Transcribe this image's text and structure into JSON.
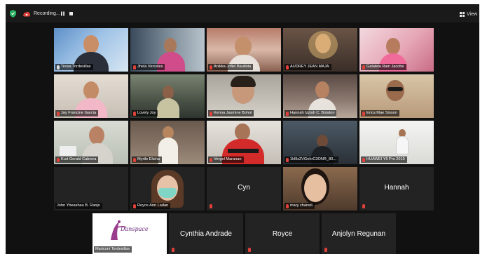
{
  "topbar": {
    "recording_label": "Recording...",
    "view_label": "View"
  },
  "colors": {
    "background": "#111111",
    "active_speaker_border": "#c9dc3c",
    "muted_mic": "#e0413a",
    "recording_red": "#e0413a",
    "shield_green": "#27ae60"
  },
  "participants": [
    {
      "name": "Tessa Tordesillas",
      "type": "video",
      "active": true
    },
    {
      "name": "Jhela Verceles",
      "type": "video"
    },
    {
      "name": "Anikka Jofiel Bautista",
      "type": "video"
    },
    {
      "name": "AUDREY JEAN MAJA",
      "type": "video"
    },
    {
      "name": "Galateia Rain Jacobe",
      "type": "video"
    },
    {
      "name": "Jay Francine Garcia",
      "type": "video"
    },
    {
      "name": "Lovely Joy",
      "type": "video"
    },
    {
      "name": "Kenna Jasmine Bohol",
      "type": "video"
    },
    {
      "name": "Hannah Izziah C. Botalon",
      "type": "video"
    },
    {
      "name": "Erica Mae Sioson",
      "type": "video"
    },
    {
      "name": "Kurt Gerald Cabrera",
      "type": "video"
    },
    {
      "name": "Myrtle Elisha",
      "type": "video"
    },
    {
      "name": "Vergel Maranan",
      "type": "video"
    },
    {
      "name": "1kl9s2VGnhrC3ONR_80...",
      "type": "video"
    },
    {
      "name": "HUAWEI Y6 Pro 2019",
      "type": "video"
    },
    {
      "name": "John Yheashau B. Ranjo",
      "type": "blank"
    },
    {
      "name": "Royce Ann Ladan",
      "type": "avatar"
    },
    {
      "name": "Cyn",
      "type": "name-only"
    },
    {
      "name": "mary chanell",
      "type": "video"
    },
    {
      "name": "Hannah",
      "type": "name-only"
    },
    {
      "name": "Mariconi Tordesillas",
      "type": "logo",
      "logo_text": "Danspace"
    },
    {
      "name": "Cynthia Andrade",
      "type": "name-only"
    },
    {
      "name": "Royce",
      "type": "name-only"
    },
    {
      "name": "Anjolyn Regunan",
      "type": "name-only"
    }
  ]
}
